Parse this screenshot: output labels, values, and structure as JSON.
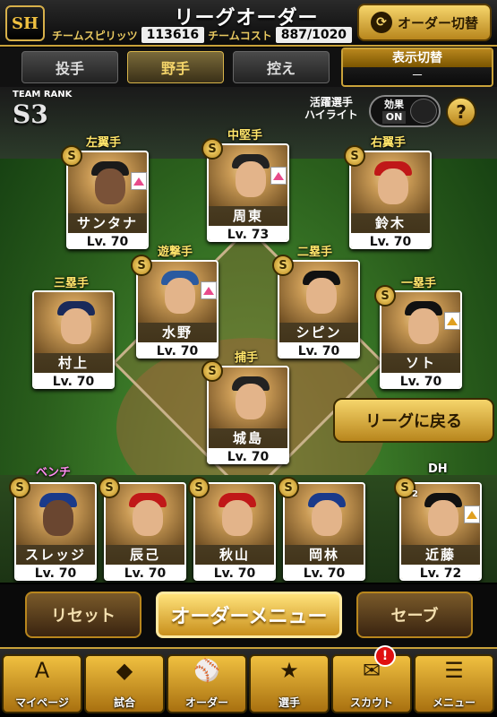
{
  "header": {
    "logo_text": "SH",
    "title": "リーグオーダー",
    "team_spirits_label": "チームスピリッツ",
    "team_spirits_value": "113616",
    "team_cost_label": "チームコスト",
    "team_cost_value": "887/1020",
    "order_switch_label": "オーダー切替"
  },
  "tabs": [
    {
      "label": "投手",
      "active": false
    },
    {
      "label": "野手",
      "active": true
    },
    {
      "label": "控え",
      "active": false
    }
  ],
  "display_switch": {
    "title": "表示切替",
    "value": "－"
  },
  "team_rank": {
    "label": "TEAM RANK",
    "value": "S3"
  },
  "highlight": {
    "label_line1": "活躍選手",
    "label_line2": "ハイライト",
    "toggle_label": "効果",
    "toggle_state": "ON"
  },
  "help_label": "?",
  "lineup": [
    {
      "position": "左翼手",
      "name": "サンタナ",
      "level": "Lv. 70",
      "coin": "S"
    },
    {
      "position": "中堅手",
      "name": "周東",
      "level": "Lv. 73",
      "coin": "S"
    },
    {
      "position": "右翼手",
      "name": "鈴木",
      "level": "Lv. 70",
      "coin": "S"
    },
    {
      "position": "遊撃手",
      "name": "水野",
      "level": "Lv. 70",
      "coin": "S"
    },
    {
      "position": "二塁手",
      "name": "シピン",
      "level": "Lv. 70",
      "coin": "S"
    },
    {
      "position": "三塁手",
      "name": "村上",
      "level": "Lv. 70",
      "coin": "S"
    },
    {
      "position": "一塁手",
      "name": "ソト",
      "level": "Lv. 70",
      "coin": "S"
    },
    {
      "position": "捕手",
      "name": "城島",
      "level": "Lv. 70",
      "coin": "S"
    }
  ],
  "bench_label": "ベンチ",
  "dh_label": "DH",
  "bench": [
    {
      "name": "スレッジ",
      "level": "Lv. 70",
      "coin": "S"
    },
    {
      "name": "辰己",
      "level": "Lv. 70",
      "coin": "S"
    },
    {
      "name": "秋山",
      "level": "Lv. 70",
      "coin": "S"
    },
    {
      "name": "岡林",
      "level": "Lv. 70",
      "coin": "S"
    },
    {
      "name": "近藤",
      "level": "Lv. 72",
      "coin": "S",
      "coin_sub": "2"
    }
  ],
  "back_to_league_label": "リーグに戻る",
  "actions": {
    "reset": "リセット",
    "order_menu": "オーダーメニュー",
    "save": "セーブ"
  },
  "nav": [
    {
      "label": "マイページ",
      "icon": "A"
    },
    {
      "label": "試合",
      "icon": "◆"
    },
    {
      "label": "オーダー",
      "icon": "⚾"
    },
    {
      "label": "選手",
      "icon": "★"
    },
    {
      "label": "スカウト",
      "icon": "✉"
    },
    {
      "label": "メニュー",
      "icon": "☰"
    }
  ],
  "scout_badge": "!",
  "colors": {
    "gold": "#c9a23a",
    "accent": "#f6d56b",
    "position_label": "#ffe56a",
    "bench_label": "#ff8cf0"
  }
}
